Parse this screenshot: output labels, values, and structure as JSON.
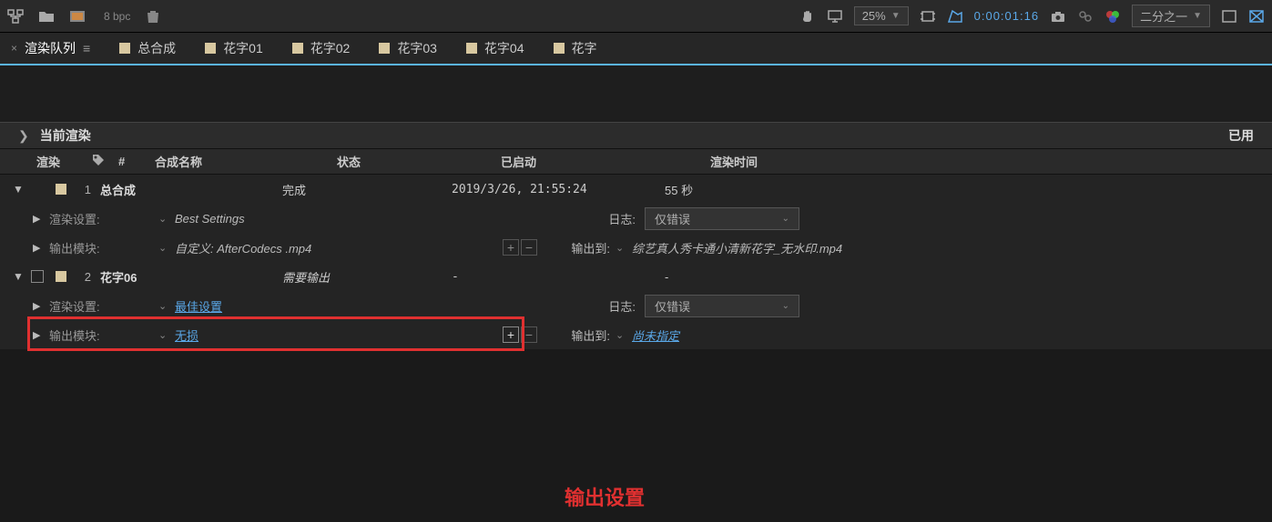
{
  "toolbar": {
    "bpc": "8 bpc",
    "zoom": "25%",
    "timecode": "0:00:01:16",
    "resolution": "二分之一"
  },
  "tabs": {
    "active": "渲染队列",
    "items": [
      "总合成",
      "花字01",
      "花字02",
      "花字03",
      "花字04",
      "花字"
    ]
  },
  "section": {
    "current_render": "当前渲染",
    "right": "已用"
  },
  "columns": {
    "render": "渲染",
    "num": "#",
    "comp_name": "合成名称",
    "status": "状态",
    "started": "已启动",
    "render_time": "渲染时间"
  },
  "labels": {
    "render_settings": "渲染设置:",
    "output_module": "输出模块:",
    "log": "日志:",
    "output_to": "输出到:"
  },
  "items": [
    {
      "num": "1",
      "name": "总合成",
      "status": "完成",
      "started": "2019/3/26, 21:55:24",
      "render_time": "55 秒",
      "render_settings": "Best Settings",
      "output_module": "自定义: AfterCodecs .mp4",
      "log": "仅错误",
      "output_to": "综艺真人秀卡通小清新花字_无水印.mp4"
    },
    {
      "num": "2",
      "name": "花字06",
      "status": "需要输出",
      "started": "-",
      "render_time": "-",
      "render_settings": "最佳设置",
      "output_module": "无损",
      "log": "仅错误",
      "output_to": "尚未指定"
    }
  ],
  "annotation": "输出设置"
}
